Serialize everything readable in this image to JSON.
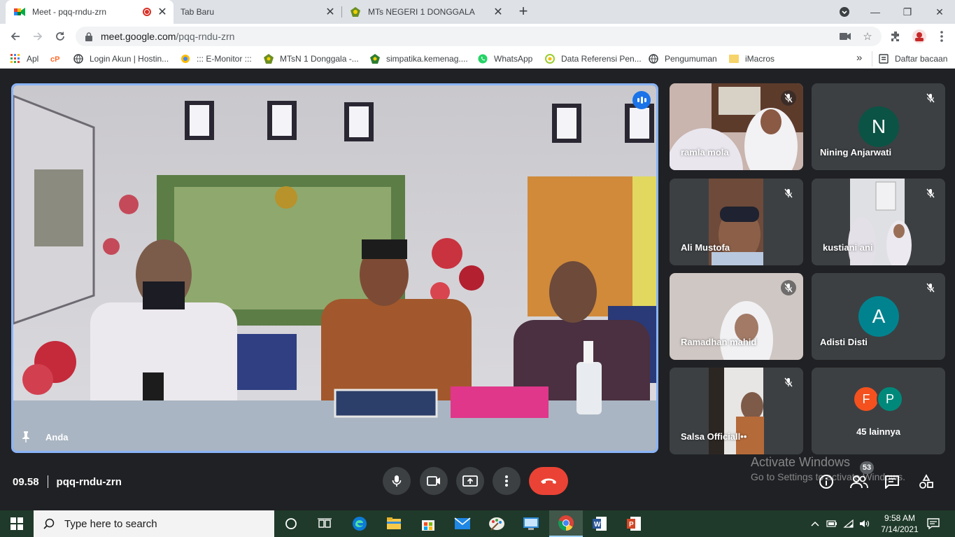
{
  "browser": {
    "tabs": [
      {
        "title": "Meet - pqq-rndu-zrn",
        "active": true,
        "recording": true,
        "close": "✕"
      },
      {
        "title": "Tab Baru",
        "active": false,
        "close": "✕"
      },
      {
        "title": "MTs NEGERI 1 DONGGALA",
        "active": false,
        "close": "✕"
      }
    ],
    "new_tab": "+",
    "window_controls": {
      "minimize": "—",
      "restore": "❐",
      "close": "✕"
    },
    "address": {
      "host": "meet.google.com",
      "path": "/pqq-rndu-zrn"
    }
  },
  "bookmarks": {
    "items": [
      {
        "label": "Apl",
        "icon": "apps-grid-icon"
      },
      {
        "label": "",
        "icon": "cpanel-icon"
      },
      {
        "label": "Login Akun | Hostin...",
        "icon": "globe-icon"
      },
      {
        "label": "::: E-Monitor :::",
        "icon": "emonitor-icon"
      },
      {
        "label": "MTsN 1 Donggala -...",
        "icon": "kemenag-icon"
      },
      {
        "label": "simpatika.kemenag....",
        "icon": "kemenag-icon"
      },
      {
        "label": "WhatsApp",
        "icon": "whatsapp-icon"
      },
      {
        "label": "Data Referensi Pen...",
        "icon": "data-ref-icon"
      },
      {
        "label": "Pengumuman",
        "icon": "globe-icon"
      },
      {
        "label": "iMacros",
        "icon": "folder-icon"
      }
    ],
    "overflow": "»",
    "reading_list": "Daftar bacaan"
  },
  "meet": {
    "main": {
      "name": "Anda"
    },
    "participants": [
      {
        "name": "ramla mola",
        "type": "video"
      },
      {
        "name": "Nining Anjarwati",
        "type": "avatar",
        "initial": "N",
        "color": "#0b5345"
      },
      {
        "name": "Ali Mustofa",
        "type": "video"
      },
      {
        "name": "kustiani ani",
        "type": "video"
      },
      {
        "name": "Ramadhan mahid",
        "type": "video"
      },
      {
        "name": "Adisti Disti",
        "type": "avatar",
        "initial": "A",
        "color": "#00838f"
      },
      {
        "name": "Salsa Officiall••",
        "type": "video"
      }
    ],
    "more": {
      "label": "45 lainnya",
      "initials": [
        "F",
        "P"
      ],
      "colors": [
        "#f4511e",
        "#00897b"
      ]
    },
    "time": "09.58",
    "code": "pqq-rndu-zrn",
    "people_count": "53",
    "end_color": "#ea4335",
    "accent": "#8ab4f8"
  },
  "watermark": {
    "line1": "Activate Windows",
    "line2": "Go to Settings to activate Windows."
  },
  "taskbar": {
    "search_placeholder": "Type here to search",
    "time": "9:58 AM",
    "date": "7/14/2021"
  }
}
